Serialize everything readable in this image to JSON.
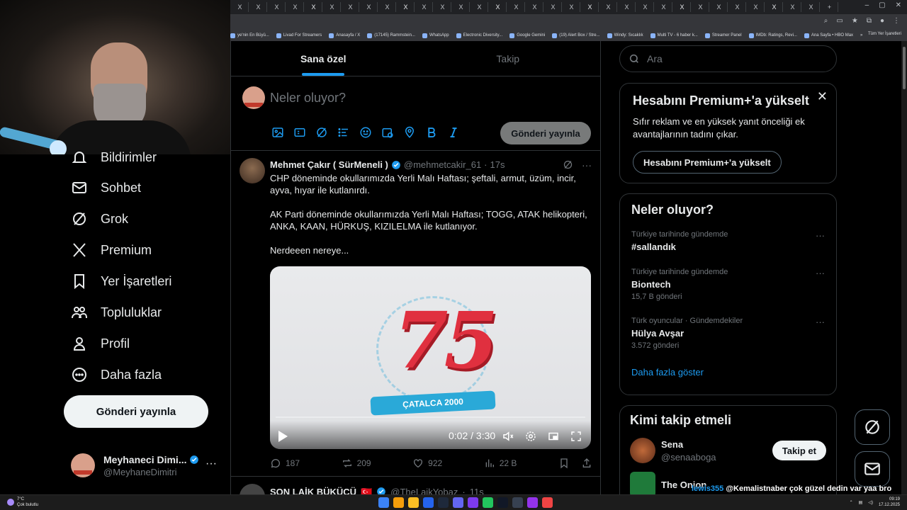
{
  "browser": {
    "tabs": [
      "X",
      "X",
      "X",
      "X",
      "X",
      "X",
      "X",
      "X",
      "X",
      "X",
      "X",
      "X",
      "X",
      "X",
      "X",
      "X",
      "X",
      "X",
      "X",
      "X",
      "X",
      "X",
      "X",
      "X",
      "X",
      "X",
      "X",
      "X",
      "X",
      "X",
      "X",
      "X",
      "X",
      "X",
      "X",
      "X"
    ],
    "window_controls": [
      "–",
      "▢",
      "✕"
    ],
    "bookmarks": [
      "ye'nin En Büyü...",
      "Livad For Streamers",
      "Anasayfa / X",
      "(17145) Rammstein...",
      "WhatsApp",
      "Electronic Diversity...",
      "Google Gemini",
      "(19) Alert Box / Stre...",
      "Windy: Sıcaklık",
      "Multi TV - 6 haber k...",
      "Streamer Panel",
      "IMDb: Ratings, Revi...",
      "Ana Sayfa • HBO Max"
    ],
    "bookmarks_overflow": "»",
    "all_bookmarks": "Tüm Yer İşaretleri"
  },
  "sidebar": {
    "items": [
      {
        "label": "Bildirimler",
        "icon": "bell-icon"
      },
      {
        "label": "Sohbet",
        "icon": "mail-icon"
      },
      {
        "label": "Grok",
        "icon": "grok-icon"
      },
      {
        "label": "Premium",
        "icon": "x-logo-icon"
      },
      {
        "label": "Yer İşaretleri",
        "icon": "bookmark-icon"
      },
      {
        "label": "Topluluklar",
        "icon": "communities-icon"
      },
      {
        "label": "Profil",
        "icon": "profile-icon"
      },
      {
        "label": "Daha fazla",
        "icon": "more-circle-icon"
      }
    ],
    "post_button": "Gönderi yayınla",
    "account": {
      "name": "Meyhaneci Dimi...",
      "handle": "@MeyhaneDimitri",
      "more": "···"
    }
  },
  "timeline": {
    "tabs": [
      {
        "label": "Sana özel",
        "active": true
      },
      {
        "label": "Takip",
        "active": false
      }
    ],
    "composer": {
      "placeholder": "Neler oluyor?",
      "post_button": "Gönderi yayınla"
    },
    "tweet": {
      "name": "Mehmet Çakır ( SürMeneli )",
      "handle": "@mehmetcakir_61",
      "separator": "·",
      "time": "17s",
      "more": "···",
      "body": [
        "CHP döneminde okullarımızda Yerli Malı Haftası; şeftali, armut, üzüm, incir, ayva, hıyar ile kutlanırdı.",
        "AK Parti döneminde okullarımızda Yerli Malı Haftası; TOGG, ATAK helikopteri, ANKA, KAAN, HÜRKUŞ, KIZILELMA ile kutlanıyor.",
        "Nerdeeen nereye..."
      ],
      "video": {
        "big_text": "75",
        "ribbon": "ÇATALCA 2000",
        "time": "0:02 / 3:30",
        "progress": 0.01
      },
      "stats": {
        "replies": "187",
        "reposts": "209",
        "likes": "922",
        "views": "22 B"
      }
    },
    "next_tweet": {
      "name": "SON LAİK BÜKÜCÜ",
      "flag": "🇹🇷",
      "handle": "@TheLaikYobaz",
      "separator": "·",
      "time": "11s"
    }
  },
  "right": {
    "search_placeholder": "Ara",
    "premium": {
      "title": "Hesabını Premium+'a yükselt",
      "text": "Sıfır reklam ve en yüksek yanıt önceliği ek avantajlarının tadını çıkar.",
      "button": "Hesabını Premium+'a yükselt",
      "close": "✕"
    },
    "trends": {
      "title": "Neler oluyor?",
      "items": [
        {
          "context": "Türkiye tarihinde gündemde",
          "name": "#sallandık",
          "count": ""
        },
        {
          "context": "Türkiye tarihinde gündemde",
          "name": "Biontech",
          "count": "15,7 B gönderi"
        },
        {
          "context": "Türk oyuncular · Gündemdekiler",
          "name": "Hülya Avşar",
          "count": "3.572 gönderi"
        }
      ],
      "more": "···",
      "show_more": "Daha fazla göster"
    },
    "who_to_follow": {
      "title": "Kimi takip etmeli",
      "users": [
        {
          "name": "Sena",
          "handle": "@senaaboga",
          "button": "Takip et"
        },
        {
          "name": "The Onion",
          "handle": ""
        }
      ]
    }
  },
  "chat_overlay": {
    "user": "lewis355",
    "message": "@Kemalistnaber çok güzel dedin var yaa bro aynen öyle"
  },
  "taskbar": {
    "weather_temp": "7°C",
    "weather_text": "Çok bulutlu",
    "time": "09:19",
    "date": "17.12.2025"
  },
  "colors": {
    "accent": "#1d9bf0",
    "background": "#000000",
    "border": "#2f3336",
    "muted": "#71767b"
  }
}
